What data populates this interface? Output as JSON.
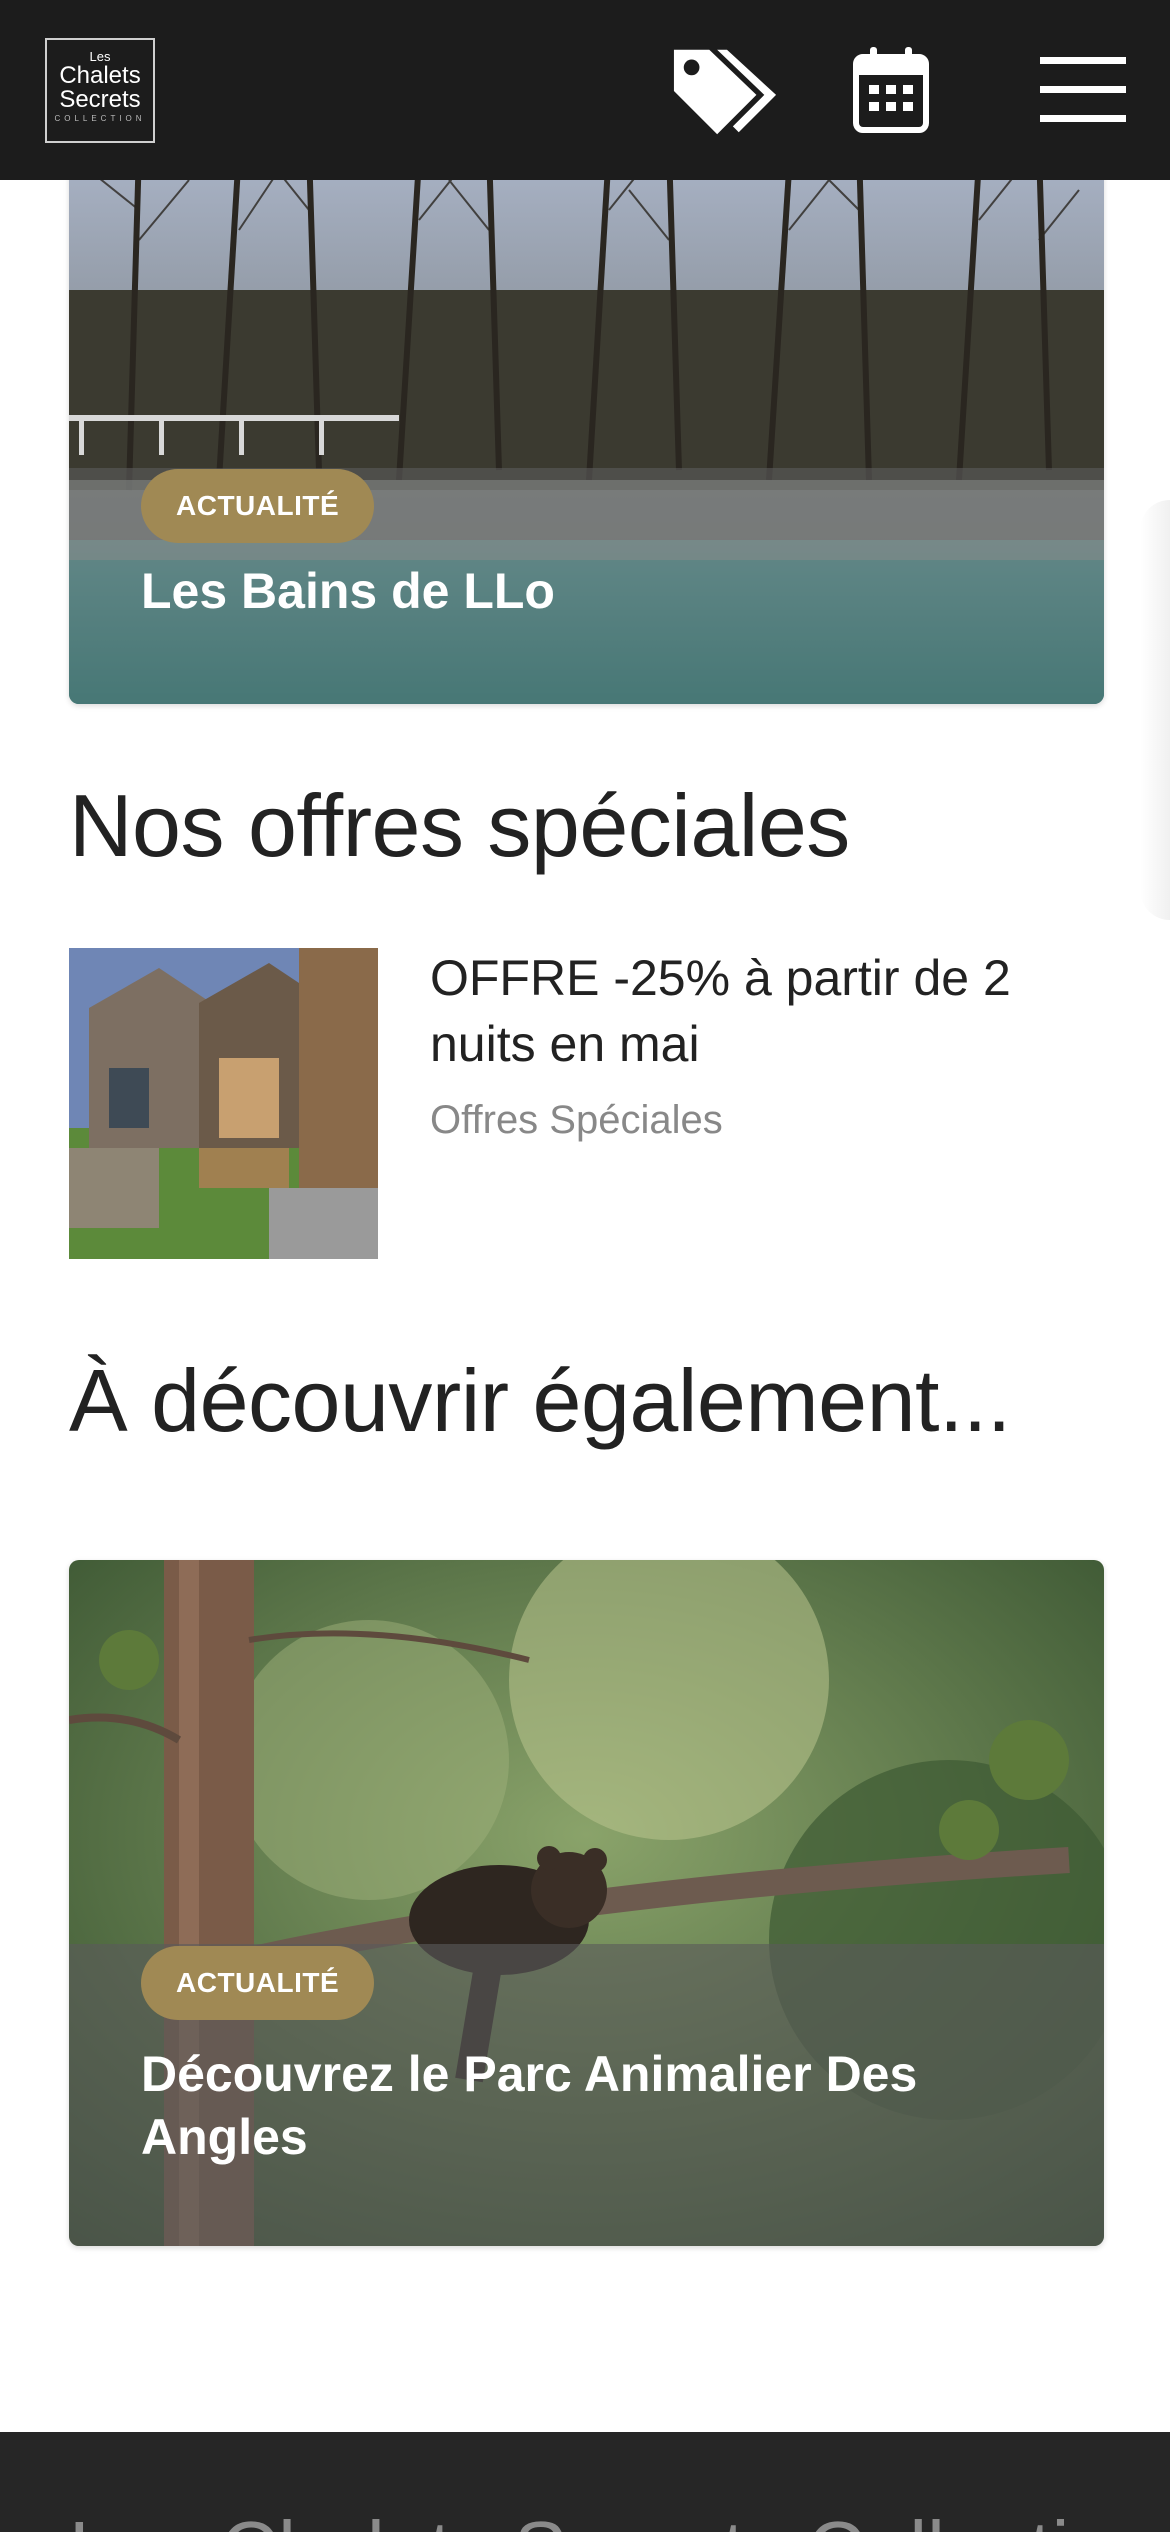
{
  "header": {
    "logo": {
      "line1": "Les",
      "line2": "Chalets",
      "line3": "Secrets",
      "line4": "COLLECTION"
    },
    "icons": [
      "tags-icon",
      "calendar-icon",
      "menu-icon"
    ]
  },
  "top_card": {
    "badge": "ACTUALITÉ",
    "title": "Les Bains de LLo"
  },
  "special_offers": {
    "heading": "Nos offres spéciales",
    "items": [
      {
        "title": "OFFRE -25% à partir de 2 nuits en mai",
        "category": "Offres Spéciales"
      }
    ]
  },
  "discover": {
    "heading": "À découvrir également...",
    "card": {
      "badge": "ACTUALITÉ",
      "title": "Découvrez le Parc Animalier Des Angles"
    }
  },
  "footer": {
    "title": "Les Chalets Secrets Collection"
  },
  "colors": {
    "header_bg": "#1c1c1c",
    "badge_bg": "#a08954",
    "footer_bg": "#262626"
  }
}
